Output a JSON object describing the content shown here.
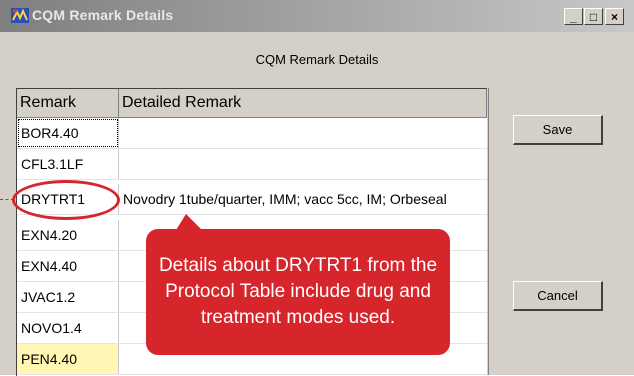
{
  "window": {
    "title": "CQM Remark Details",
    "app_icon": "cqm-app-icon",
    "controls": {
      "minimize": "_",
      "maximize": "□",
      "close": "×"
    }
  },
  "header": {
    "text": "CQM Remark Details"
  },
  "table": {
    "columns": [
      "Remark",
      "Detailed Remark"
    ],
    "rows": [
      {
        "remark": "BOR4.40",
        "detail": ""
      },
      {
        "remark": "CFL3.1LF",
        "detail": ""
      },
      {
        "remark": "DRYTRT1",
        "detail": "Novodry 1tube/quarter, IMM; vacc 5cc, IM; Orbeseal"
      },
      {
        "remark": "EXN4.20",
        "detail": ""
      },
      {
        "remark": "EXN4.40",
        "detail": ""
      },
      {
        "remark": "JVAC1.2",
        "detail": ""
      },
      {
        "remark": "NOVO1.4",
        "detail": ""
      },
      {
        "remark": "PEN4.40",
        "detail": ""
      }
    ]
  },
  "buttons": {
    "save": "Save",
    "cancel": "Cancel"
  },
  "annotation": {
    "callout_text": "Details about DRYTRT1 from the Protocol Table include drug and treatment modes used.",
    "color": "#d6262c"
  }
}
